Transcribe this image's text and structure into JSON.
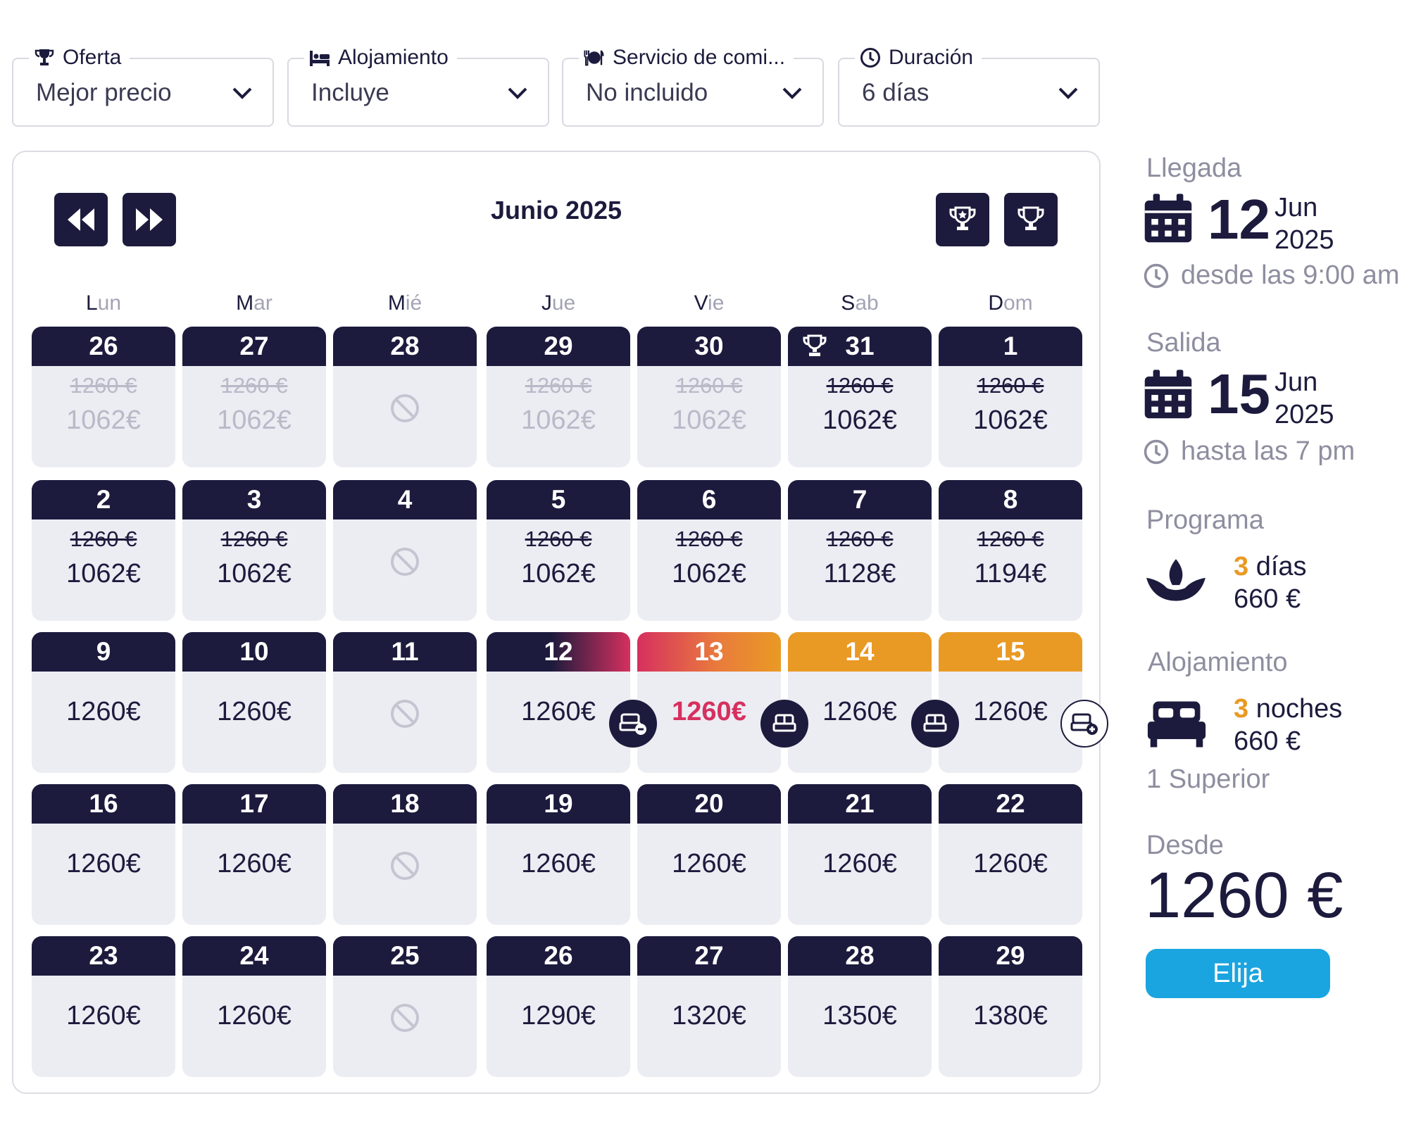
{
  "filters": {
    "oferta": {
      "label": "Oferta",
      "value": "Mejor precio"
    },
    "alojamiento": {
      "label": "Alojamiento",
      "value": "Incluye"
    },
    "comida": {
      "label": "Servicio de comi...",
      "value": "No incluido"
    },
    "duracion": {
      "label": "Duración",
      "value": "6 días"
    }
  },
  "calendar": {
    "title": "Junio 2025",
    "weekdays": [
      {
        "a": "L",
        "b": "un"
      },
      {
        "a": "M",
        "b": "ar"
      },
      {
        "a": "M",
        "b": "ié"
      },
      {
        "a": "J",
        "b": "ue"
      },
      {
        "a": "V",
        "b": "ie"
      },
      {
        "a": "S",
        "b": "ab"
      },
      {
        "a": "D",
        "b": "om"
      }
    ],
    "weeks": [
      [
        {
          "day": "26",
          "old": "1260 €",
          "price": "1062€",
          "past": true
        },
        {
          "day": "27",
          "old": "1260 €",
          "price": "1062€",
          "past": true
        },
        {
          "day": "28",
          "na": true
        },
        {
          "day": "29",
          "old": "1260 €",
          "price": "1062€",
          "past": true
        },
        {
          "day": "30",
          "old": "1260 €",
          "price": "1062€",
          "past": true
        },
        {
          "day": "31",
          "old": "1260 €",
          "price": "1062€",
          "trophy": true
        },
        {
          "day": "1",
          "old": "1260 €",
          "price": "1062€"
        }
      ],
      [
        {
          "day": "2",
          "old": "1260 €",
          "price": "1062€"
        },
        {
          "day": "3",
          "old": "1260 €",
          "price": "1062€"
        },
        {
          "day": "4",
          "na": true
        },
        {
          "day": "5",
          "old": "1260 €",
          "price": "1062€"
        },
        {
          "day": "6",
          "old": "1260 €",
          "price": "1062€"
        },
        {
          "day": "7",
          "old": "1260 €",
          "price": "1128€"
        },
        {
          "day": "8",
          "old": "1260 €",
          "price": "1194€"
        }
      ],
      [
        {
          "day": "9",
          "price": "1260€"
        },
        {
          "day": "10",
          "price": "1260€"
        },
        {
          "day": "11",
          "na": true
        },
        {
          "day": "12",
          "price": "1260€",
          "head": "g12"
        },
        {
          "day": "13",
          "price": "1260€",
          "head": "g13",
          "pink": true
        },
        {
          "day": "14",
          "price": "1260€",
          "head": "g14"
        },
        {
          "day": "15",
          "price": "1260€",
          "head": "g14"
        }
      ],
      [
        {
          "day": "16",
          "price": "1260€"
        },
        {
          "day": "17",
          "price": "1260€"
        },
        {
          "day": "18",
          "na": true
        },
        {
          "day": "19",
          "price": "1260€"
        },
        {
          "day": "20",
          "price": "1260€"
        },
        {
          "day": "21",
          "price": "1260€"
        },
        {
          "day": "22",
          "price": "1260€"
        }
      ],
      [
        {
          "day": "23",
          "price": "1260€"
        },
        {
          "day": "24",
          "price": "1260€"
        },
        {
          "day": "25",
          "na": true
        },
        {
          "day": "26",
          "price": "1290€"
        },
        {
          "day": "27",
          "price": "1320€"
        },
        {
          "day": "28",
          "price": "1350€"
        },
        {
          "day": "29",
          "price": "1380€"
        }
      ]
    ]
  },
  "summary": {
    "arrival": {
      "label": "Llegada",
      "day": "12",
      "month": "Jun",
      "year": "2025",
      "time": "desde las 9:00 am"
    },
    "departure": {
      "label": "Salida",
      "day": "15",
      "month": "Jun",
      "year": "2025",
      "time": "hasta las 7 pm"
    },
    "program": {
      "label": "Programa",
      "count": "3",
      "unit": "días",
      "price": "660 €"
    },
    "lodging": {
      "label": "Alojamiento",
      "count": "3",
      "unit": "noches",
      "price": "660 €",
      "room": "1 Superior"
    },
    "from": {
      "label": "Desde",
      "price": "1260 €"
    },
    "button": "Elija"
  },
  "icons": {
    "oferta": "trophy-icon",
    "alojamiento": "bed-icon",
    "comida": "cutlery-icon",
    "duracion": "clock-icon",
    "unavailable": "no-entry-icon"
  },
  "colors": {
    "navy": "#1c1b3d",
    "orange": "#e99a24",
    "pink": "#d6305f",
    "blue": "#1aa5e0",
    "cell": "#ececf3"
  }
}
